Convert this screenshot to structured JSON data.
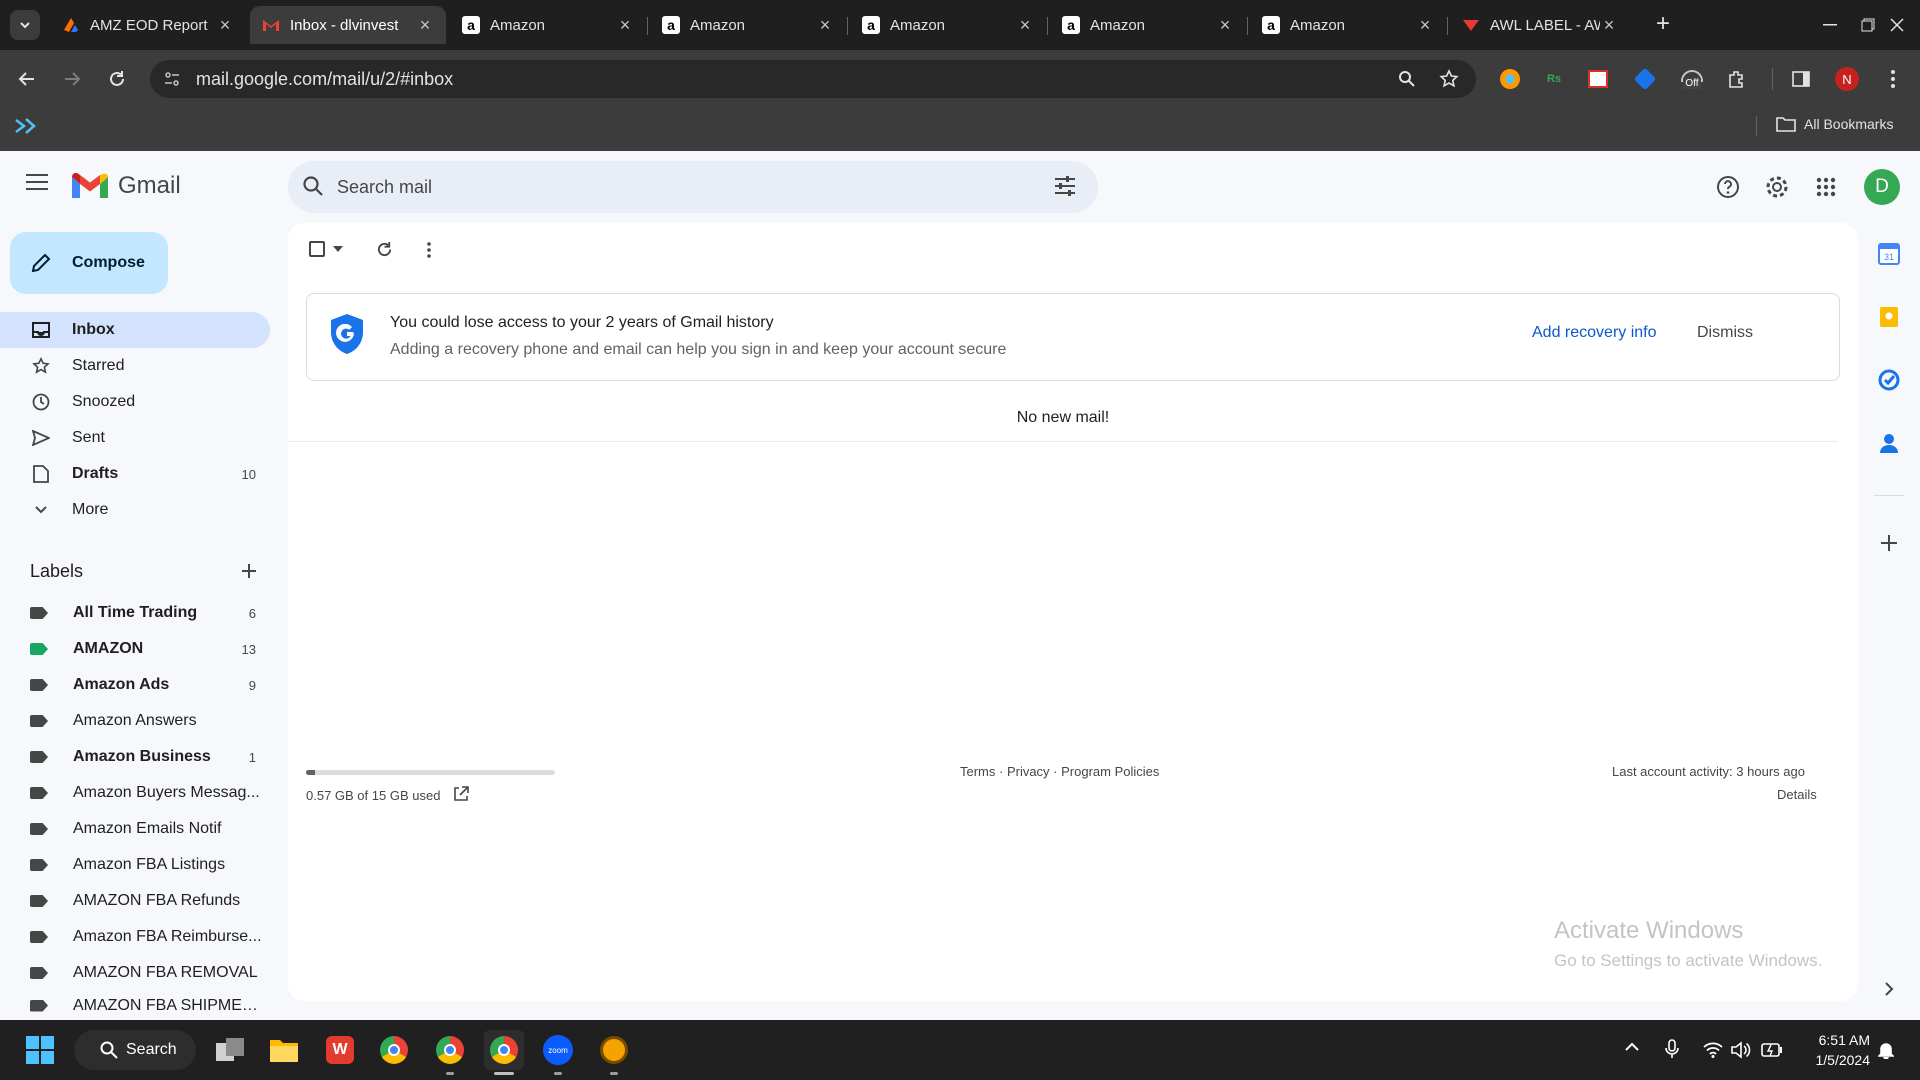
{
  "browser": {
    "tabs": [
      {
        "title": "AMZ EOD Report",
        "icon": "orange-app-icon",
        "active": false
      },
      {
        "title": "Inbox - dlvinvest",
        "icon": "gmail-icon",
        "active": true
      },
      {
        "title": "Amazon",
        "icon": "amazon-icon",
        "active": false
      },
      {
        "title": "Amazon",
        "icon": "amazon-icon",
        "active": false
      },
      {
        "title": "Amazon",
        "icon": "amazon-icon",
        "active": false
      },
      {
        "title": "Amazon",
        "icon": "amazon-icon",
        "active": false
      },
      {
        "title": "Amazon",
        "icon": "amazon-icon",
        "active": false
      },
      {
        "title": "AWL LABEL - AW",
        "icon": "awl-icon",
        "active": false
      }
    ],
    "url": "mail.google.com/mail/u/2/#inbox",
    "bookmarks_label": "All Bookmarks",
    "profile_initial": "N",
    "extension_badge": "Off"
  },
  "gmail": {
    "logo_text": "Gmail",
    "search_placeholder": "Search mail",
    "compose_label": "Compose",
    "avatar_initial": "D",
    "nav": [
      {
        "label": "Inbox",
        "count": "",
        "icon": "inbox-icon",
        "active": true,
        "bold": true
      },
      {
        "label": "Starred",
        "count": "",
        "icon": "star-icon",
        "active": false,
        "bold": false
      },
      {
        "label": "Snoozed",
        "count": "",
        "icon": "clock-icon",
        "active": false,
        "bold": false
      },
      {
        "label": "Sent",
        "count": "",
        "icon": "send-icon",
        "active": false,
        "bold": false
      },
      {
        "label": "Drafts",
        "count": "10",
        "icon": "draft-icon",
        "active": false,
        "bold": true
      },
      {
        "label": "More",
        "count": "",
        "icon": "chevron-down-icon",
        "active": false,
        "bold": false
      }
    ],
    "labels_title": "Labels",
    "labels": [
      {
        "label": "All Time Trading",
        "count": "6",
        "bold": true,
        "color": "#444746"
      },
      {
        "label": "AMAZON",
        "count": "13",
        "bold": true,
        "color": "#16a765"
      },
      {
        "label": "Amazon Ads",
        "count": "9",
        "bold": true,
        "color": "#444746"
      },
      {
        "label": "Amazon Answers",
        "count": "",
        "bold": false,
        "color": "#444746"
      },
      {
        "label": "Amazon Business",
        "count": "1",
        "bold": true,
        "color": "#444746"
      },
      {
        "label": "Amazon Buyers Messag...",
        "count": "",
        "bold": false,
        "color": "#444746"
      },
      {
        "label": "Amazon Emails Notif",
        "count": "",
        "bold": false,
        "color": "#444746"
      },
      {
        "label": "Amazon FBA Listings",
        "count": "",
        "bold": false,
        "color": "#444746"
      },
      {
        "label": "AMAZON FBA Refunds",
        "count": "",
        "bold": false,
        "color": "#444746"
      },
      {
        "label": "Amazon FBA Reimburse...",
        "count": "",
        "bold": false,
        "color": "#444746"
      },
      {
        "label": "AMAZON FBA REMOVAL",
        "count": "",
        "bold": false,
        "color": "#444746"
      },
      {
        "label": "AMAZON FBA SHIPMEN...",
        "count": "",
        "bold": false,
        "color": "#444746"
      }
    ],
    "banner": {
      "title": "You could lose access to your 2 years of Gmail history",
      "subtitle": "Adding a recovery phone and email can help you sign in and keep your account secure",
      "action": "Add recovery info",
      "dismiss": "Dismiss"
    },
    "empty_message": "No new mail!",
    "storage": {
      "text": "0.57 GB of 15 GB used",
      "fraction": 0.038
    },
    "footer_links": "Terms · Privacy · Program Policies",
    "activity": "Last account activity: 3 hours ago",
    "details": "Details",
    "watermark_title": "Activate Windows",
    "watermark_sub": "Go to Settings to activate Windows."
  },
  "taskbar": {
    "search_label": "Search",
    "time": "6:51 AM",
    "date": "1/5/2024"
  },
  "colors": {
    "accent": "#0b57d0",
    "compose_bg": "#c2e7ff",
    "active_nav": "#d3e3fd",
    "chrome_dark": "#1f1f1f"
  }
}
